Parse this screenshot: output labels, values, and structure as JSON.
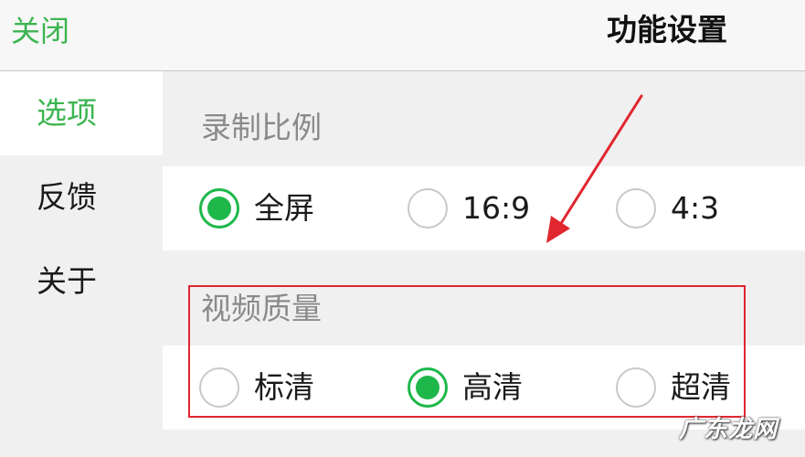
{
  "header": {
    "close_label": "关闭",
    "title": "功能设置"
  },
  "sidebar": {
    "items": [
      {
        "label": "选项",
        "active": true
      },
      {
        "label": "反馈",
        "active": false
      },
      {
        "label": "关于",
        "active": false
      }
    ]
  },
  "recording_ratio": {
    "title": "录制比例",
    "options": [
      {
        "label": "全屏",
        "checked": true
      },
      {
        "label": "16:9",
        "checked": false
      },
      {
        "label": "4:3",
        "checked": false
      }
    ]
  },
  "video_quality": {
    "title": "视频质量",
    "options": [
      {
        "label": "标清",
        "checked": false
      },
      {
        "label": "高清",
        "checked": true
      },
      {
        "label": "超清",
        "checked": false
      }
    ]
  },
  "annotations": {
    "highlight_color": "#e0262f",
    "arrow_color": "#e0262f"
  },
  "colors": {
    "accent": "#3cb550",
    "radio_checked": "#1eb84a"
  },
  "watermark": "广东龙网"
}
